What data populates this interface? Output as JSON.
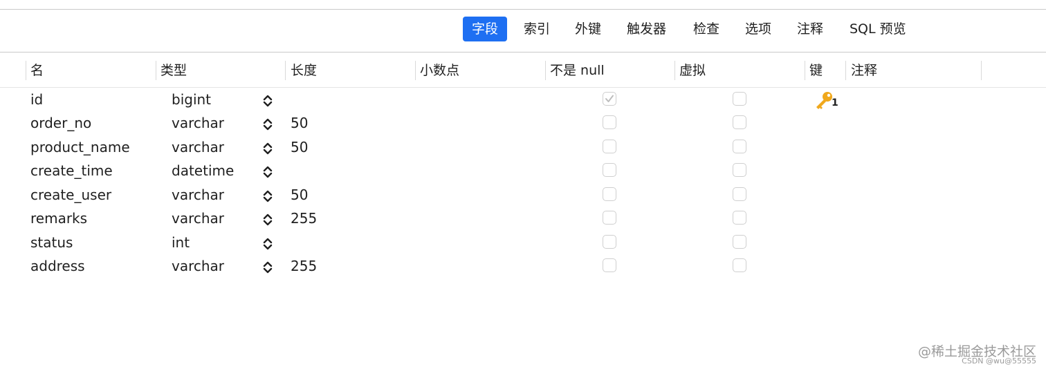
{
  "tabs": [
    {
      "label": "字段",
      "active": true
    },
    {
      "label": "索引",
      "active": false
    },
    {
      "label": "外键",
      "active": false
    },
    {
      "label": "触发器",
      "active": false
    },
    {
      "label": "检查",
      "active": false
    },
    {
      "label": "选项",
      "active": false
    },
    {
      "label": "注释",
      "active": false
    },
    {
      "label": "SQL 预览",
      "active": false
    }
  ],
  "columns": [
    "名",
    "类型",
    "长度",
    "小数点",
    "不是 null",
    "虚拟",
    "键",
    "注释"
  ],
  "rows": [
    {
      "name": "id",
      "type": "bigint",
      "length": "",
      "not_null": true,
      "virtual": false,
      "key": "1"
    },
    {
      "name": "order_no",
      "type": "varchar",
      "length": "50",
      "not_null": false,
      "virtual": false,
      "key": ""
    },
    {
      "name": "product_name",
      "type": "varchar",
      "length": "50",
      "not_null": false,
      "virtual": false,
      "key": ""
    },
    {
      "name": "create_time",
      "type": "datetime",
      "length": "",
      "not_null": false,
      "virtual": false,
      "key": ""
    },
    {
      "name": "create_user",
      "type": "varchar",
      "length": "50",
      "not_null": false,
      "virtual": false,
      "key": ""
    },
    {
      "name": "remarks",
      "type": "varchar",
      "length": "255",
      "not_null": false,
      "virtual": false,
      "key": ""
    },
    {
      "name": "status",
      "type": "int",
      "length": "",
      "not_null": false,
      "virtual": false,
      "key": ""
    },
    {
      "name": "address",
      "type": "varchar",
      "length": "255",
      "not_null": false,
      "virtual": false,
      "key": ""
    }
  ],
  "watermark": {
    "main": "@稀土掘金技术社区",
    "sub": "CSDN @wu@55555"
  },
  "colors": {
    "active_tab": "#1e6ff2",
    "key_icon": "#f0a81c"
  }
}
